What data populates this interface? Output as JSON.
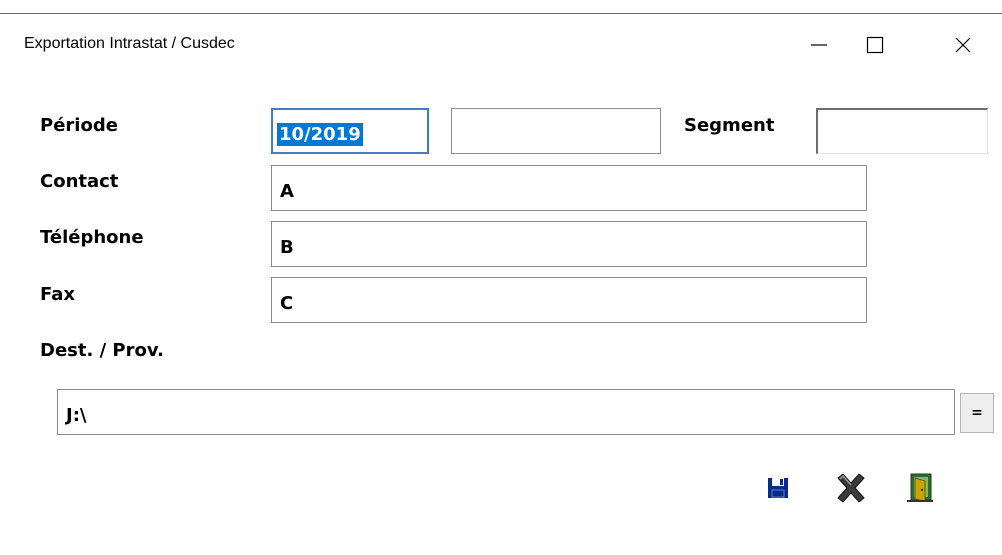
{
  "window": {
    "title": "Exportation Intrastat / Cusdec",
    "controls": {
      "minimize": "minimize-icon",
      "maximize": "maximize-icon",
      "close": "close-icon"
    }
  },
  "form": {
    "periode_label": "Période",
    "periode_value": "10/2019",
    "periode_extra": "",
    "segment_label": "Segment",
    "segment_value": "",
    "contact_label": "Contact",
    "contact_value": "A",
    "telephone_label": "Téléphone",
    "telephone_value": "B",
    "fax_label": "Fax",
    "fax_value": "C",
    "dest_label": "Dest. / Prov.",
    "dest_value": "J:\\",
    "browse_label": "="
  },
  "toolbar": {
    "icons": [
      "save-icon",
      "cancel-icon",
      "exit-door-icon"
    ]
  },
  "colors": {
    "selection": "#0078d7",
    "focus_border": "#3f7cc9",
    "save_icon": "#0a2a8a"
  }
}
